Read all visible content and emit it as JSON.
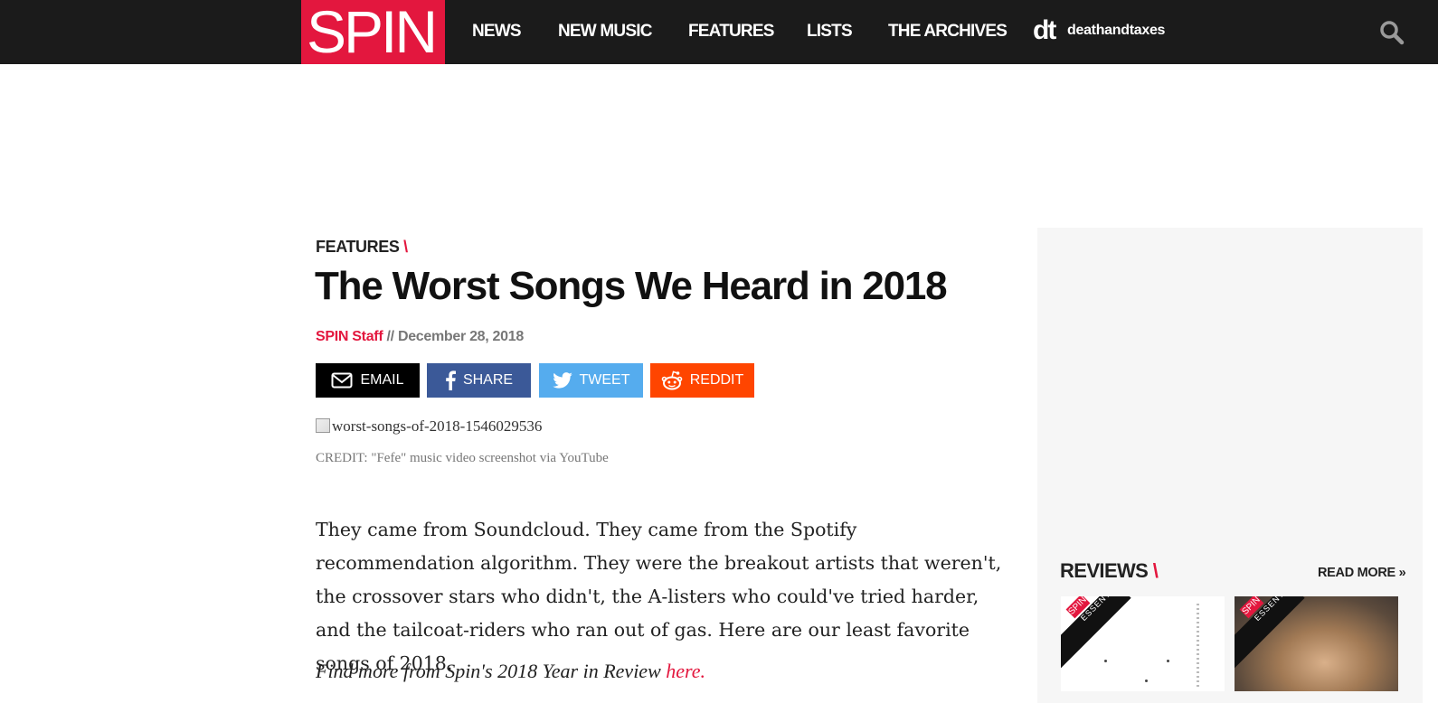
{
  "brand": {
    "logo_text": "SPIN",
    "accent": "#e3173e",
    "nav_bg": "#1b1b1b"
  },
  "nav": {
    "items": [
      "NEWS",
      "NEW MUSIC",
      "FEATURES",
      "LISTS",
      "THE ARCHIVES"
    ],
    "partner_mark": "dt",
    "partner_name": "deathandtaxes",
    "search_icon": "search-icon"
  },
  "article": {
    "section": "FEATURES",
    "section_slash": "\\",
    "title": "The Worst Songs We Heard in 2018",
    "author": "SPIN Staff",
    "date_sep": " // ",
    "date": "December 28, 2018",
    "image_alt": "worst-songs-of-2018-1546029536",
    "credit": "CREDIT: \"Fefe\" music video screenshot via YouTube",
    "body": "They came from Soundcloud. They came from the Spotify recommendation algorithm. They were the breakout artists that weren't, the crossover stars who didn't, the A-listers who could've tried harder, and the tailcoat-riders who ran out of gas. Here are our least favorite songs of 2018.",
    "more_prefix": "Find more from Spin's 2018 Year in Review ",
    "more_link": "here",
    "more_suffix": "."
  },
  "share": {
    "email": {
      "label": "EMAIL",
      "icon": "envelope-icon",
      "color": "#000000"
    },
    "facebook": {
      "label": "SHARE",
      "icon": "facebook-icon",
      "color": "#3b5998"
    },
    "twitter": {
      "label": "TWEET",
      "icon": "twitter-icon",
      "color": "#55acee"
    },
    "reddit": {
      "label": "REDDIT",
      "icon": "reddit-icon",
      "color": "#ff4500"
    }
  },
  "sidebar": {
    "reviews_title": "REVIEWS",
    "reviews_slash": "\\",
    "read_more": "READ MORE »",
    "ribbon_brand": "SPIN",
    "ribbon_label": "ESSENTIAL"
  }
}
